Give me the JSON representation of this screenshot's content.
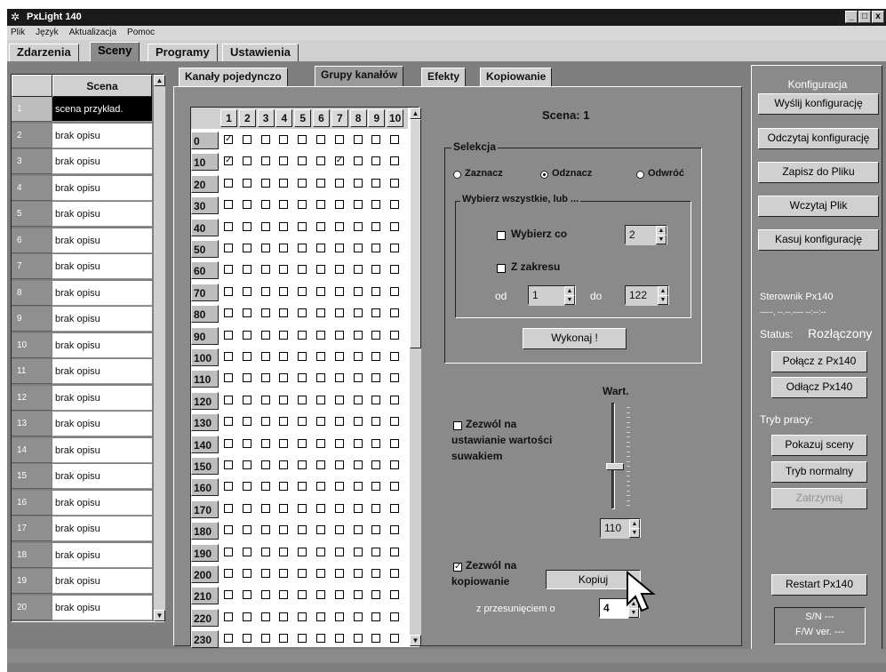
{
  "window": {
    "title": "PxLight 140",
    "buttons": [
      "_",
      "□",
      "x"
    ]
  },
  "menu": [
    "Plik",
    "Język",
    "Aktualizacja",
    "Pomoc"
  ],
  "main_tabs": [
    "Zdarzenia",
    "Sceny",
    "Programy",
    "Ustawienia"
  ],
  "sub_tabs": [
    "Kanały pojedynczo",
    "Grupy kanałów",
    "Efekty",
    "Kopiowanie"
  ],
  "scenes": {
    "header": "Scena",
    "rows": [
      {
        "num": "1",
        "desc": "scena przykład."
      },
      {
        "num": "2",
        "desc": "brak opisu"
      },
      {
        "num": "3",
        "desc": "brak opisu"
      },
      {
        "num": "4",
        "desc": "brak opisu"
      },
      {
        "num": "5",
        "desc": "brak opisu"
      },
      {
        "num": "6",
        "desc": "brak opisu"
      },
      {
        "num": "7",
        "desc": "brak opisu"
      },
      {
        "num": "8",
        "desc": "brak opisu"
      },
      {
        "num": "9",
        "desc": "brak opisu"
      },
      {
        "num": "10",
        "desc": "brak opisu"
      },
      {
        "num": "11",
        "desc": "brak opisu"
      },
      {
        "num": "12",
        "desc": "brak opisu"
      },
      {
        "num": "13",
        "desc": "brak opisu"
      },
      {
        "num": "14",
        "desc": "brak opisu"
      },
      {
        "num": "15",
        "desc": "brak opisu"
      },
      {
        "num": "16",
        "desc": "brak opisu"
      },
      {
        "num": "17",
        "desc": "brak opisu"
      },
      {
        "num": "18",
        "desc": "brak opisu"
      },
      {
        "num": "19",
        "desc": "brak opisu"
      },
      {
        "num": "20",
        "desc": "brak opisu"
      }
    ]
  },
  "grid": {
    "cols": [
      "1",
      "2",
      "3",
      "4",
      "5",
      "6",
      "7",
      "8",
      "9",
      "10"
    ],
    "rows": [
      "0",
      "10",
      "20",
      "30",
      "40",
      "50",
      "60",
      "70",
      "80",
      "90",
      "100",
      "110",
      "120",
      "130",
      "140",
      "150",
      "160",
      "170",
      "180",
      "190",
      "200",
      "210",
      "220",
      "230"
    ],
    "checked": [
      [
        0,
        0
      ],
      [
        1,
        0
      ],
      [
        1,
        6
      ]
    ]
  },
  "scene_title": "Scena: 1",
  "selection": {
    "title": "Selekcja",
    "radios": [
      {
        "label": "Zaznacz",
        "checked": false
      },
      {
        "label": "Odznacz",
        "checked": true
      },
      {
        "label": "Odwróć",
        "checked": false
      }
    ],
    "sub_title": "Wybierz wszystkie, lub ...",
    "every_label": "Wybierz co",
    "every_value": "2",
    "range_label": "Z zakresu",
    "from_label": "od",
    "from_value": "1",
    "to_label": "do",
    "to_value": "122",
    "execute": "Wykonaj !"
  },
  "slider": {
    "label": "Wart.",
    "value": "110",
    "level": 0.43,
    "allow_label_1": "Zezwól na",
    "allow_label_2": "ustawianie wartości",
    "allow_label_3": "suwakiem"
  },
  "copy": {
    "allow_label_1": "Zezwól na",
    "allow_label_2": "kopiowanie",
    "button": "Kopiuj",
    "offset_label": "z przesunięciem o",
    "offset_value": "4"
  },
  "config": {
    "title": "Konfiguracja",
    "buttons": [
      "Wyślij konfigurację",
      "Odczytaj konfigurację",
      "Zapisz do Pliku",
      "Wczytaj Plik",
      "Kasuj konfigurację"
    ]
  },
  "controller": {
    "label": "Sterownik Px140",
    "date": "-----, --.--.---- --:--:--",
    "status_label": "Status:",
    "status_value": "Rozłączony",
    "connect": "Połącz z Px140",
    "disconnect": "Odłącz Px140",
    "mode_label": "Tryb pracy:",
    "mode_buttons": [
      "Pokazuj sceny",
      "Tryb normalny",
      "Zatrzymaj"
    ],
    "restart": "Restart Px140",
    "sn": "S/N ---",
    "fw": "F/W ver. ---"
  }
}
